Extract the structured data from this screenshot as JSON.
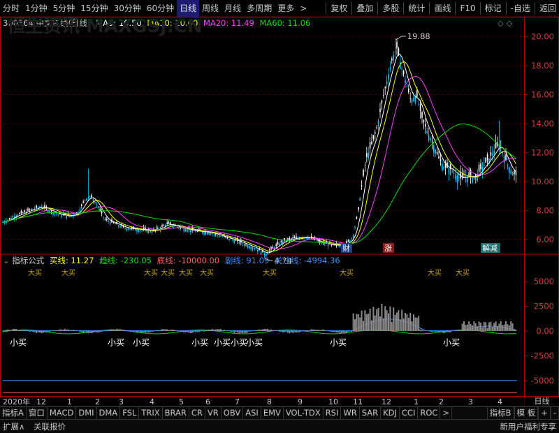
{
  "toolbar": {
    "periods": [
      "分时",
      "1分钟",
      "5分钟",
      "15分钟",
      "30分钟",
      "60分钟",
      "日线",
      "周线",
      "月线",
      "多周期",
      "更多"
    ],
    "active_period": "日线",
    "more_arrow": ">",
    "right": [
      "复权",
      "叠加",
      "多股",
      "统计",
      "画线",
      "F10",
      "标记",
      "-自选",
      "返回"
    ]
  },
  "info": {
    "stock": "300364 中文在线(日线)",
    "ma5": "MA5: 10.50",
    "ma10": "MA10: 10.60",
    "ma20": "MA20: 11.49",
    "ma60": "MA60: 11.06",
    "ctrl_icons": "◇ ◇"
  },
  "colors": {
    "ma5": "#ffffff",
    "ma10": "#ffff00",
    "ma20": "#ff40ff",
    "ma60": "#00e000",
    "up": "#00c8ff",
    "down": "#ffffff",
    "axis": "#b40000",
    "grid": "#6e0000",
    "buyline": "#ffff00",
    "trend": "#00e000",
    "bottom": "#ff6060",
    "sub": "#3a8cff",
    "attention": "#3a8cff"
  },
  "chart_data": {
    "type": "candlestick",
    "price_axis": {
      "ticks": [
        "20.00",
        "18.00",
        "16.00",
        "14.00",
        "12.00",
        "10.00",
        "8.00",
        "6.00"
      ],
      "range": [
        5.0,
        20.5
      ]
    },
    "high_label": "19.88",
    "low_label": "4.74",
    "events": [
      "财",
      "涨",
      "解减"
    ],
    "indicator_axis": {
      "ticks": [
        "5000",
        "2500",
        "0.00",
        "-2500",
        "-5000"
      ],
      "range": [
        -6500,
        6500
      ]
    },
    "date_labels": [
      "2020年",
      "12",
      "1",
      "2",
      "3",
      "4",
      "5",
      "6",
      "7",
      "8",
      "9",
      "10",
      "11",
      "12",
      "1",
      "2",
      "3",
      "4"
    ]
  },
  "indicator": {
    "name": "指标公式",
    "buy": "买线: 11.27",
    "trend": "趋线: -230.05",
    "bottom": "底线: -10000.00",
    "sub": "副线: 91.09",
    "attention": "关注线: -4994.36",
    "small_buy": "小买",
    "big_buy": "大买"
  },
  "date_right": "日线",
  "tabs": [
    "指标A",
    "窗口",
    "MACD",
    "DMI",
    "DMA",
    "FSL",
    "TRIX",
    "BRAR",
    "CR",
    "VR",
    "OBV",
    "ASI",
    "EMV",
    "VOL-TDX",
    "RSI",
    "WR",
    "SAR",
    "KDJ",
    "CCI",
    "ROC",
    ">",
    "指标B",
    "模 板",
    "+",
    "-"
  ],
  "status": {
    "left1": "扩展∧",
    "left2": "关联报价",
    "right": "新用户福利专享"
  },
  "watermark": "恒生资讯 MAXGSJ.CN"
}
